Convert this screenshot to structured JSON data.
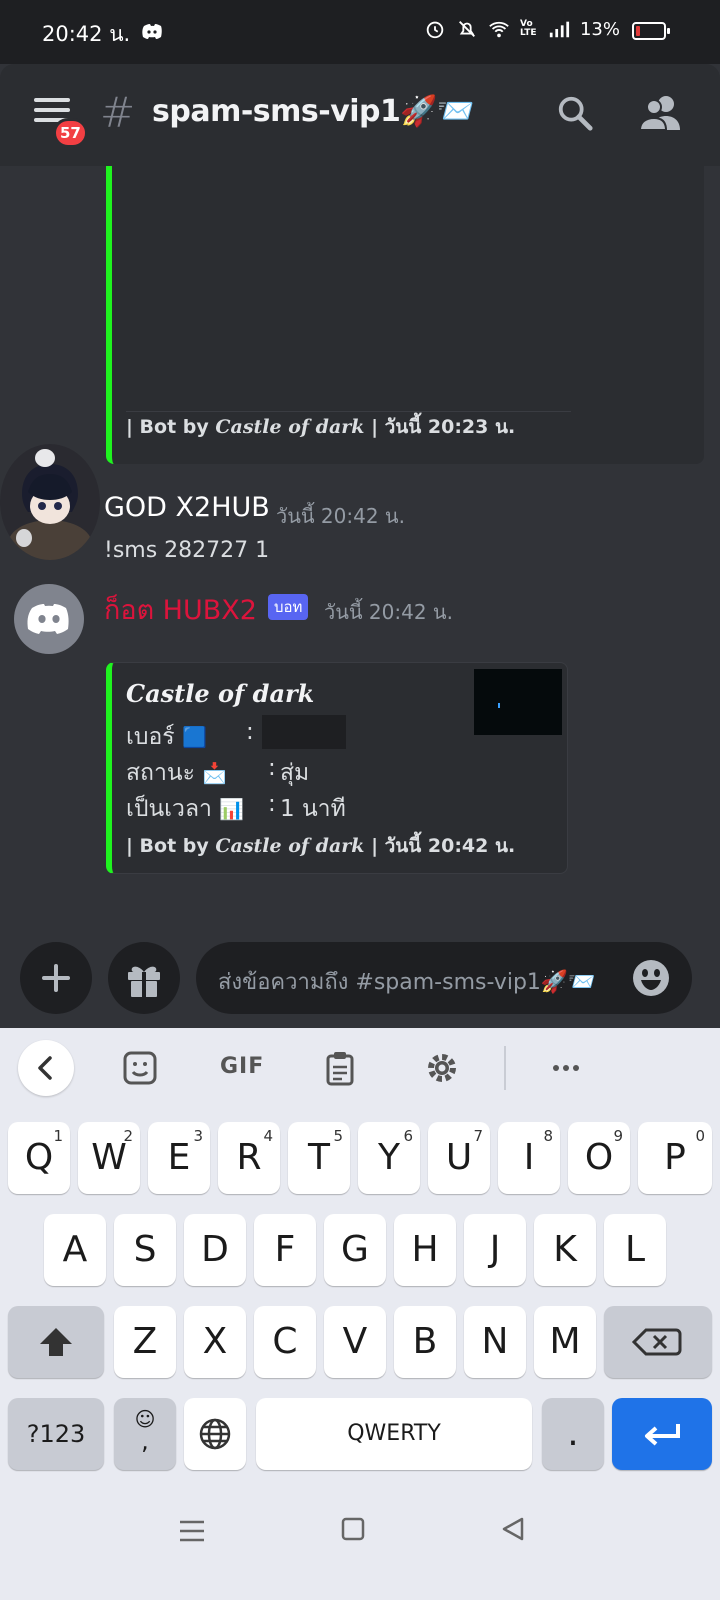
{
  "status_bar": {
    "time": "20:42 น.",
    "network": "VoLTE",
    "battery": "13%"
  },
  "header": {
    "badge": "57",
    "hash": "#",
    "channel": "spam-sms-vip1🚀📨"
  },
  "embed_top": {
    "footer_prefix": "| Bot by ",
    "footer_brand": "Castle of dark",
    "footer_sep": " | ",
    "footer_time": "วันนี้ 20:23 น."
  },
  "message1": {
    "author": "GOD X2HUB",
    "time": "วันนี้ 20:42 น.",
    "text": "!sms 282727 1",
    "author_color": "#ffffff"
  },
  "message2": {
    "author": "ก็อต HUBX2",
    "tag": "บอท",
    "time": "วันนี้ 20:42 น.",
    "author_color": "#dc143c"
  },
  "embed_bot": {
    "title": "Castle of dark",
    "fields": [
      {
        "label": "เบอร์",
        "emoji": "🟦",
        "value": ""
      },
      {
        "label": "สถานะ",
        "emoji": "📩",
        "value": "สุ่ม"
      },
      {
        "label": "เป็นเวลา",
        "emoji": "📊",
        "value": "1 นาที"
      }
    ],
    "separator": ":",
    "footer_prefix": "| Bot by ",
    "footer_brand": "Castle of dark",
    "footer_sep": " | ",
    "footer_time": "วันนี้ 20:42 น.",
    "accent": "#1ff31f"
  },
  "composer": {
    "placeholder": "ส่งข้อความถึง #spam-sms-vip1🚀📨"
  },
  "keyboard": {
    "gif": "GIF",
    "row1": [
      [
        "Q",
        "1"
      ],
      [
        "W",
        "2"
      ],
      [
        "E",
        "3"
      ],
      [
        "R",
        "4"
      ],
      [
        "T",
        "5"
      ],
      [
        "Y",
        "6"
      ],
      [
        "U",
        "7"
      ],
      [
        "I",
        "8"
      ],
      [
        "O",
        "9"
      ],
      [
        "P",
        "0"
      ]
    ],
    "row2": [
      "A",
      "S",
      "D",
      "F",
      "G",
      "H",
      "J",
      "K",
      "L"
    ],
    "row3": [
      "Z",
      "X",
      "C",
      "V",
      "B",
      "N",
      "M"
    ],
    "sym": "?123",
    "emoji_top": "☺",
    "emoji_bottom": ",",
    "space": "QWERTY",
    "period": "."
  }
}
